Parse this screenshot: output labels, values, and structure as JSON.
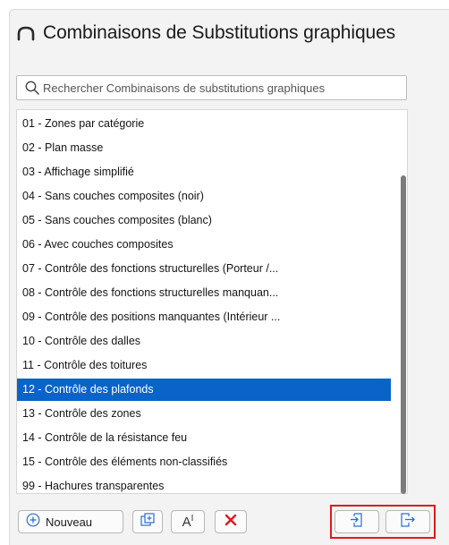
{
  "window": {
    "title": "Combinaisons de Substitutions graphiques",
    "title_icon": "arch-icon"
  },
  "search": {
    "placeholder": "Rechercher Combinaisons de substitutions graphiques",
    "value": ""
  },
  "list": {
    "selected_index": 11,
    "items": [
      "01 - Zones par catégorie",
      "02 - Plan masse",
      "03 - Affichage simplifié",
      "04 - Sans couches composites (noir)",
      "05 - Sans couches composites (blanc)",
      "06 - Avec couches composites",
      "07 - Contrôle des fonctions structurelles (Porteur /...",
      "08 - Contrôle des fonctions structurelles manquan...",
      "09 - Contrôle des positions manquantes (Intérieur ...",
      "10 - Contrôle des dalles",
      "11 - Contrôle des toitures",
      "12 - Contrôle des plafonds",
      "13 - Contrôle des zones",
      "14 - Contrôle de la résistance feu",
      "15 - Contrôle des éléments non-classifiés",
      "99 - Hachures transparentes"
    ]
  },
  "toolbar": {
    "new_label": "Nouveau",
    "new_icon": "plus-circle-icon",
    "duplicate_icon": "duplicate-icon",
    "rename_icon": "rename-text-icon",
    "rename_glyph": "A",
    "rename_glyph_sup": "I",
    "delete_icon": "delete-x-icon",
    "import_icon": "import-icon",
    "export_icon": "export-icon"
  },
  "colors": {
    "selection": "#0a63c9",
    "delete": "#e0191f",
    "highlight": "#e0191f",
    "new_icon": "#2a6fd1"
  }
}
